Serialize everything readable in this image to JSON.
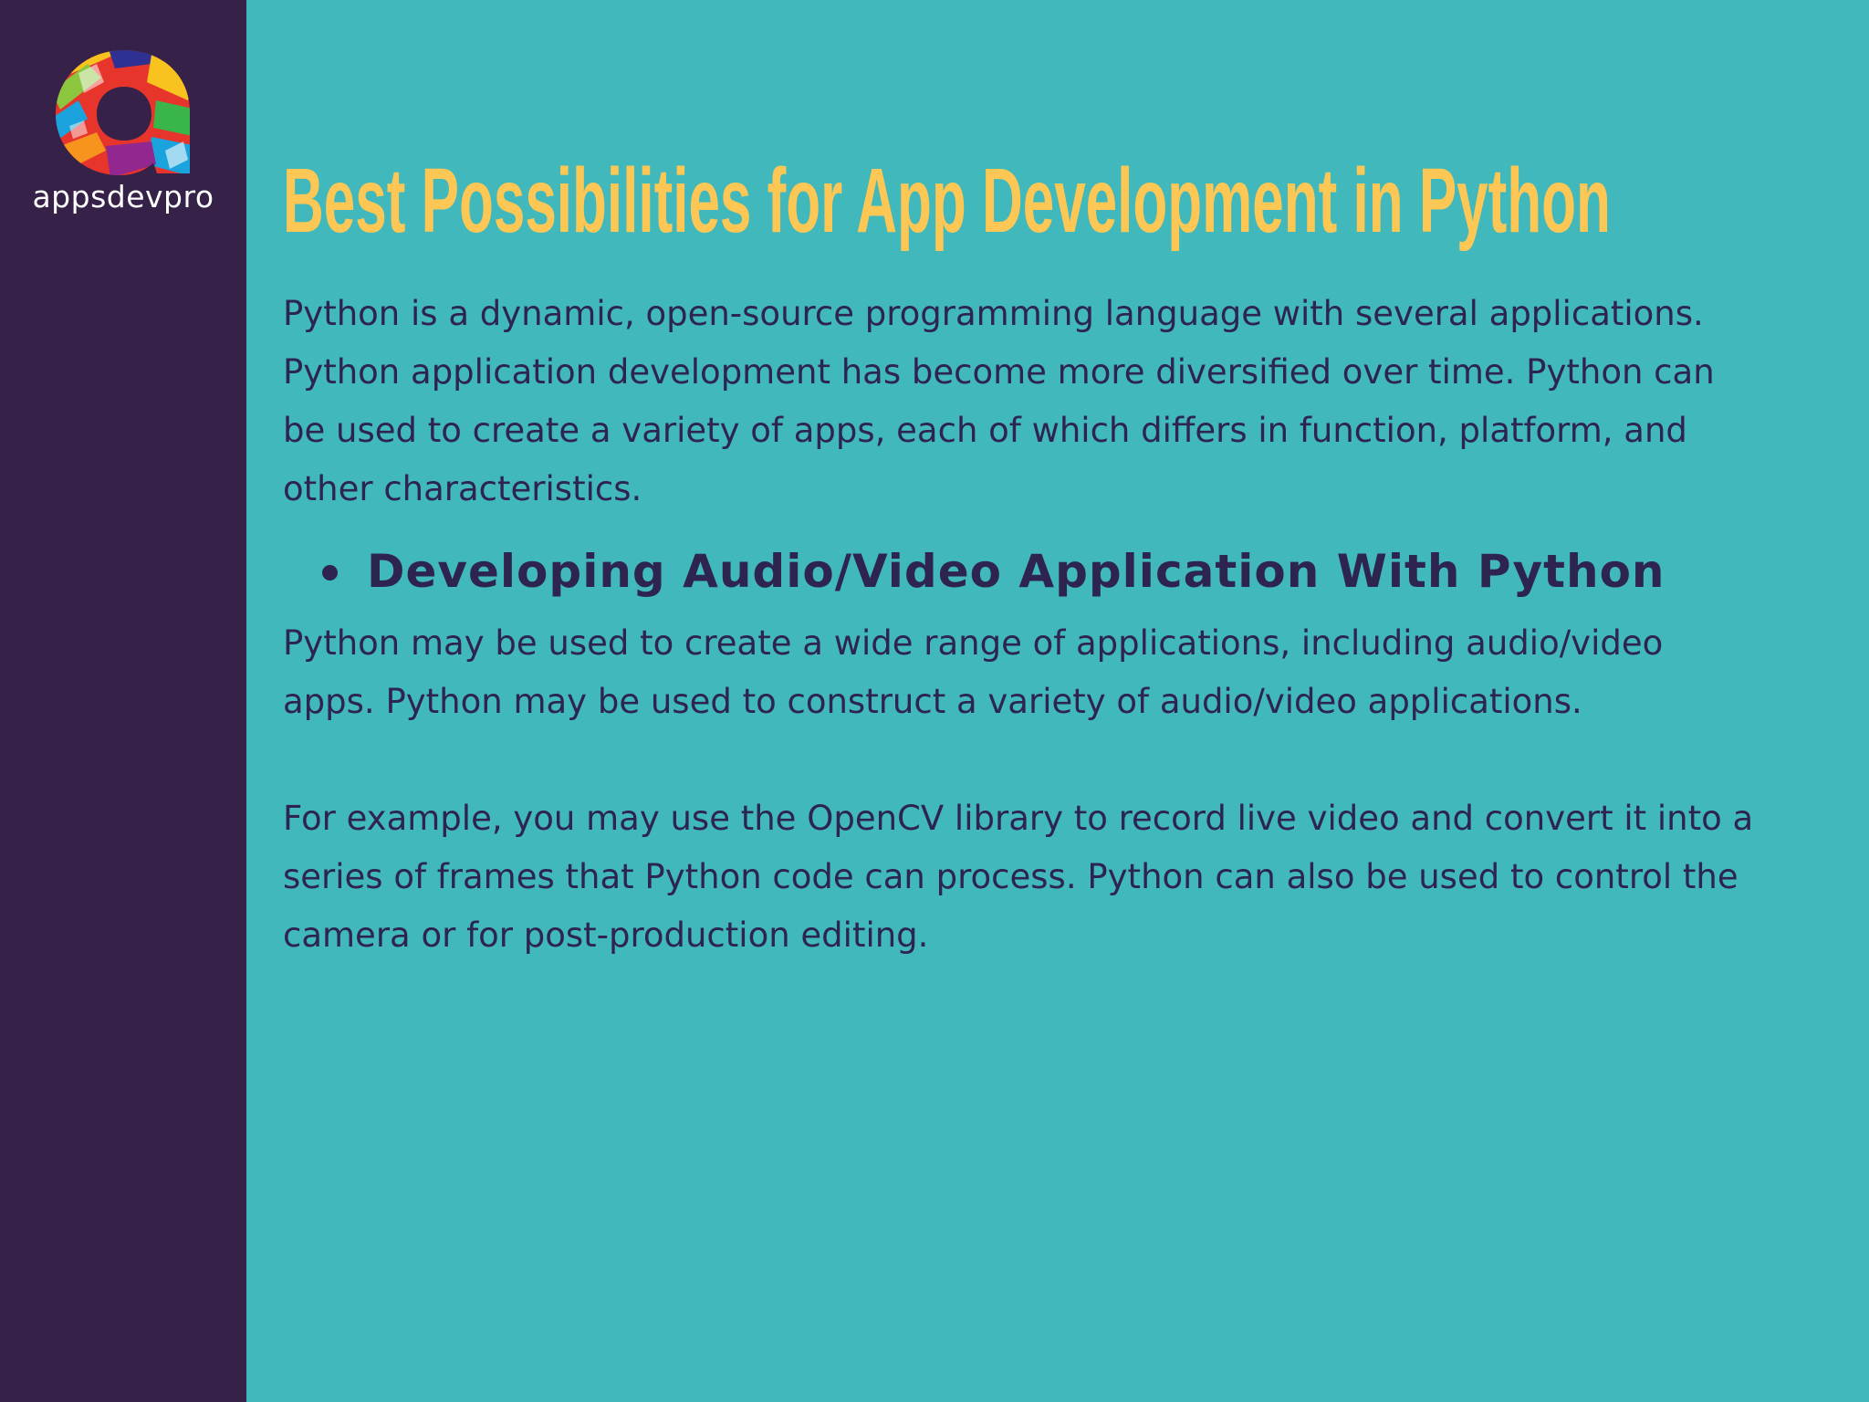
{
  "brand": {
    "name": "appsdevpro"
  },
  "colors": {
    "sidebar": "#362148",
    "background": "#41b8bb",
    "title": "#fcc755",
    "body_text": "#2e2450"
  },
  "slide": {
    "title": "Best Possibilities for App Development in Python",
    "intro": "Python is a dynamic, open-source programming language with several applications. Python application development has become more diversified over time. Python can be used to create a variety of apps, each of which differs in function, platform, and other characteristics.",
    "bullet_heading": "Developing Audio/Video Application With Python",
    "paragraph_2": "Python may be used to create a wide range of applications, including audio/video apps. Python may be used to construct a variety of audio/video applications.",
    "paragraph_3": "For example, you may use the OpenCV library to record live video and convert it into a series of frames that Python code can process. Python can also be used to control the camera or for post-production editing."
  }
}
